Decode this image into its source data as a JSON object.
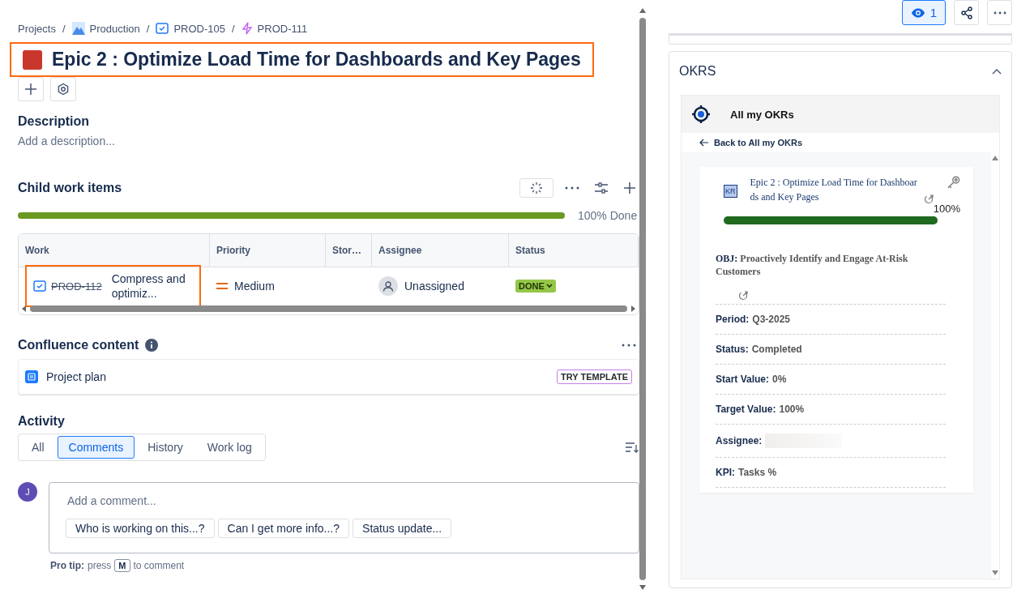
{
  "breadcrumbs": {
    "separator": "/",
    "items": [
      {
        "label": "Projects",
        "kind": "text"
      },
      {
        "label": "Production",
        "kind": "project"
      },
      {
        "label": "PROD-105",
        "kind": "task"
      },
      {
        "label": "PROD-111",
        "kind": "epic"
      }
    ]
  },
  "issue": {
    "title": "Epic 2 : Optimize Load Time for Dashboards and Key Pages",
    "highlighted": true
  },
  "description": {
    "heading": "Description",
    "placeholder": "Add a description..."
  },
  "child_items": {
    "heading": "Child work items",
    "level": 1,
    "progress_label": "100% Done",
    "columns": [
      "Work",
      "Priority",
      "Stor…",
      "Assignee",
      "Status"
    ],
    "rows": [
      {
        "key": "PROD-112",
        "summary": "Compress and optimiz...",
        "done": true,
        "highlighted": true,
        "priority": "Medium",
        "assignee": "Unassigned",
        "status": "DONE"
      }
    ]
  },
  "confluence": {
    "heading": "Confluence content",
    "items": [
      {
        "title": "Project plan",
        "badge": "TRY TEMPLATE"
      }
    ]
  },
  "activity": {
    "heading": "Activity",
    "tabs": [
      {
        "label": "All",
        "selected": false
      },
      {
        "label": "Comments",
        "selected": true
      },
      {
        "label": "History",
        "selected": false
      },
      {
        "label": "Work log",
        "selected": false
      }
    ],
    "avatar": "J",
    "placeholder": "Add a comment...",
    "suggestions": [
      "Who is working on this...?",
      "Can I get more info...?",
      "Status update..."
    ],
    "pro_tip": {
      "label": "Pro tip:",
      "before": "press",
      "key": "M",
      "after": "to comment"
    }
  },
  "watchers": "1",
  "okrs": {
    "title": "OKRS",
    "expanded": true,
    "header": "All my OKRs",
    "back": "Back to All my OKRs",
    "kr": {
      "badge": "KR",
      "title": "Epic 2 : Optimize Load Time for Dashboards and Key Pages",
      "percent": "100%",
      "level": 1
    },
    "objective": {
      "label": "OBJ:",
      "value": "Proactively Identify and Engage At-Risk Customers"
    },
    "fields": [
      {
        "label": "Period:",
        "value": "Q3-2025",
        "kind": "text"
      },
      {
        "label": "Status:",
        "value": "Completed",
        "kind": "text"
      },
      {
        "label": "Start Value:",
        "value": "0%",
        "kind": "text"
      },
      {
        "label": "Target Value:",
        "value": "100%",
        "kind": "text"
      },
      {
        "label": "Assignee:",
        "kind": "redacted"
      },
      {
        "label": "KPI:",
        "value": "Tasks %",
        "kind": "text"
      }
    ]
  }
}
